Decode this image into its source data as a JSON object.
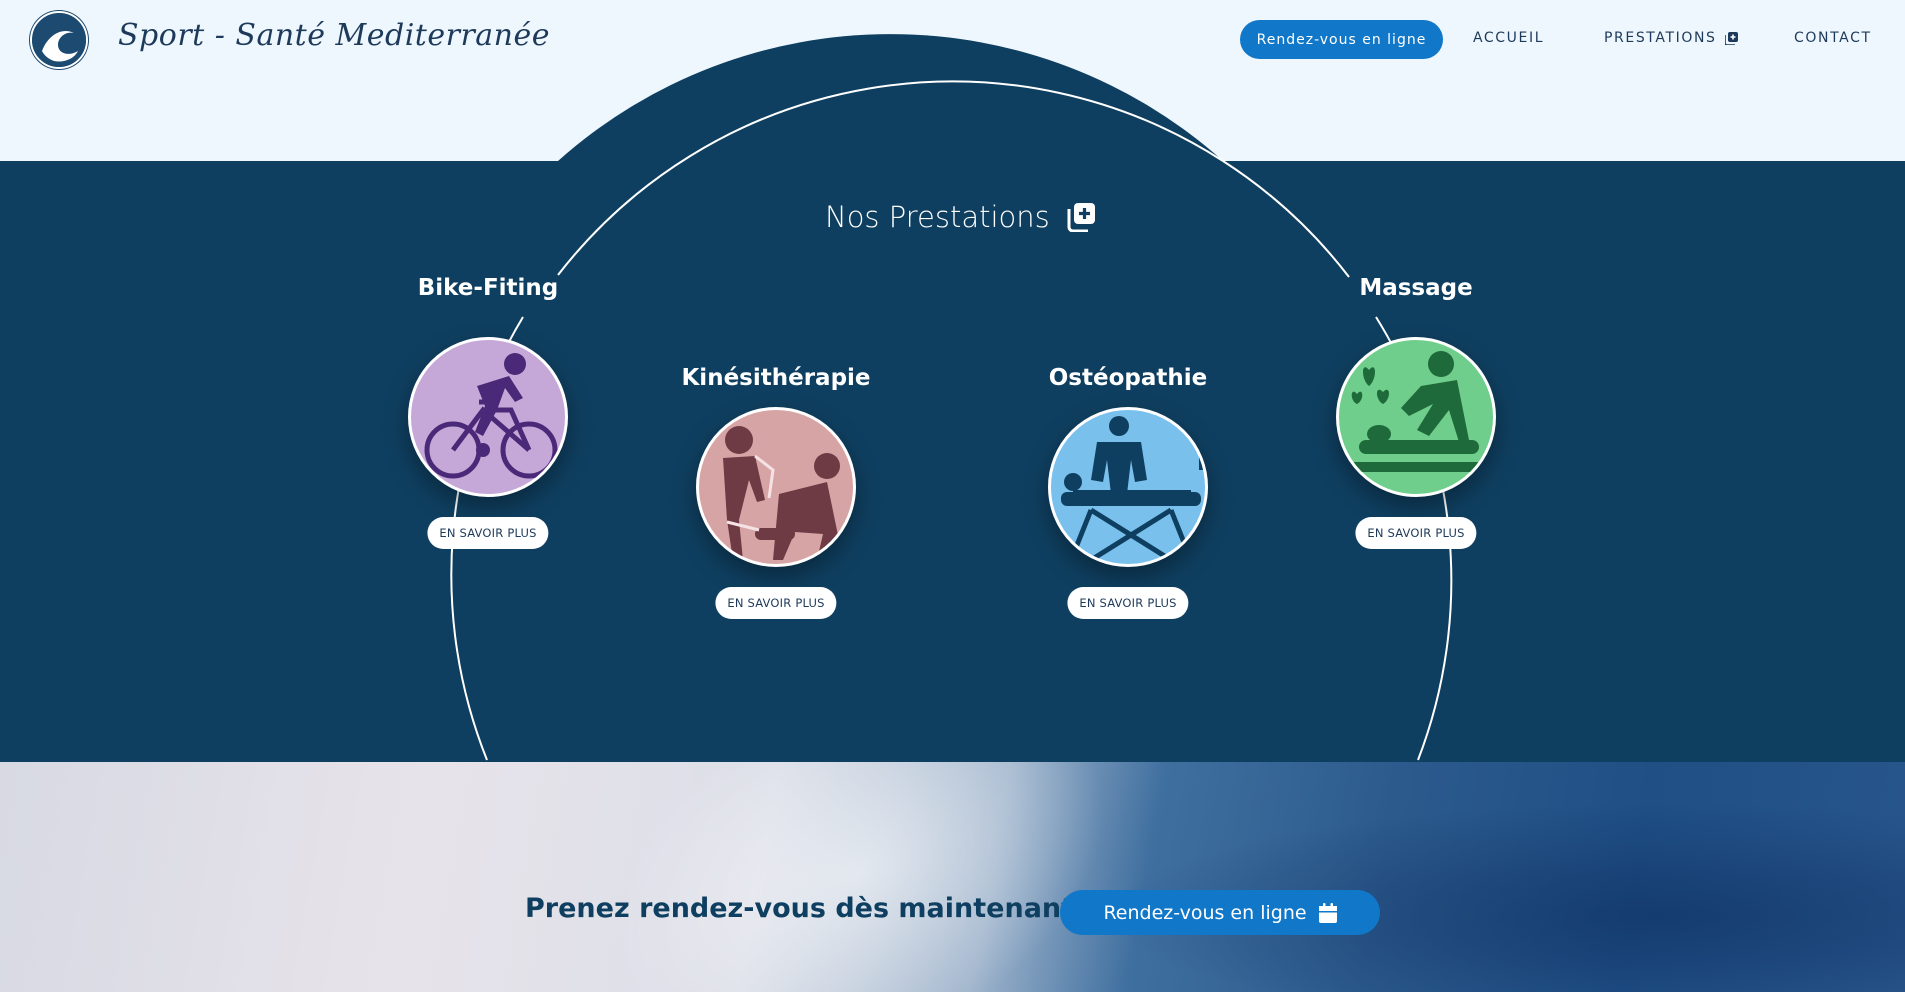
{
  "header": {
    "brand": "Sport - Santé Mediterranée",
    "cta": "Rendez-vous en ligne",
    "nav": [
      {
        "label": "ACCUEIL"
      },
      {
        "label": "PRESTATIONS"
      },
      {
        "label": "CONTACT"
      }
    ]
  },
  "services": {
    "title": "Nos Prestations",
    "items": [
      {
        "name": "Bike-Fiting",
        "button": "EN SAVOIR PLUS",
        "color": "#c6a8d8",
        "icon": "cyclist-icon"
      },
      {
        "name": "Kinésithérapie",
        "button": "EN SAVOIR PLUS",
        "color": "#d7a4a6",
        "icon": "physiotherapy-icon"
      },
      {
        "name": "Ostéopathie",
        "button": "EN SAVOIR PLUS",
        "color": "#79c0ec",
        "icon": "osteopath-icon"
      },
      {
        "name": "Massage",
        "button": "EN SAVOIR PLUS",
        "color": "#6fce8c",
        "icon": "massage-icon"
      }
    ]
  },
  "booking": {
    "text": "Prenez rendez-vous dès maintenant !",
    "button": "Rendez-vous en ligne"
  },
  "colors": {
    "navy": "#0f3f60",
    "accent": "#1177c8",
    "header_bg": "#eef7fd"
  }
}
